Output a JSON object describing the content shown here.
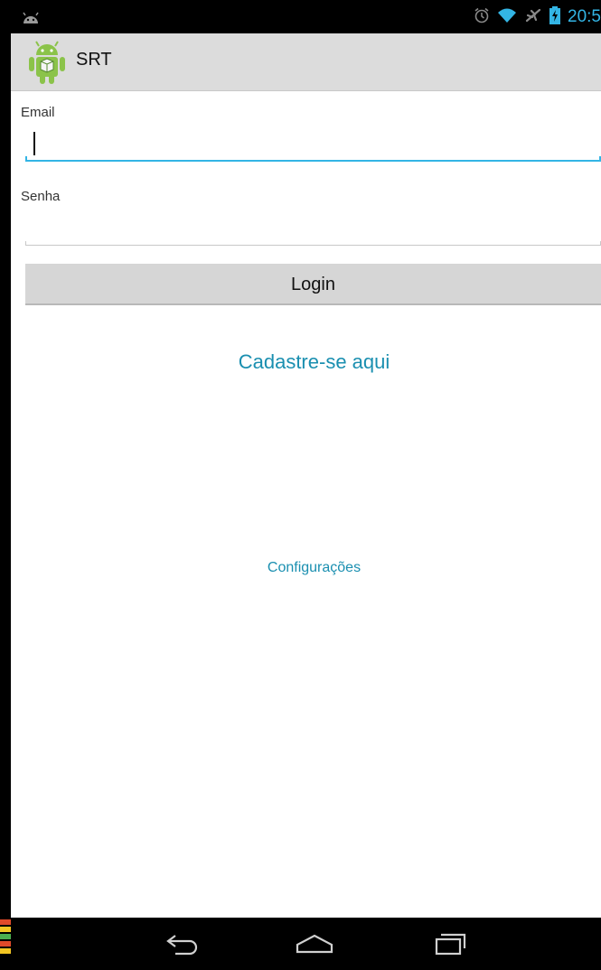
{
  "status_bar": {
    "time": "20:5",
    "icons": [
      "android-notification-icon",
      "alarm-icon",
      "wifi-icon",
      "airplane-mode-icon",
      "battery-charging-icon"
    ]
  },
  "action_bar": {
    "title": "SRT",
    "icon": "android-app-icon"
  },
  "form": {
    "email_label": "Email",
    "email_value": "",
    "password_label": "Senha",
    "password_value": "",
    "login_label": "Login"
  },
  "links": {
    "register": "Cadastre-se aqui",
    "settings": "Configurações"
  },
  "nav_bar": {
    "icons": [
      "back-icon",
      "home-icon",
      "recent-apps-icon"
    ]
  },
  "colors": {
    "accent": "#33b5e5",
    "link": "#1a8fb0",
    "action_bar": "#dcdcdc",
    "button": "#d6d6d6"
  }
}
